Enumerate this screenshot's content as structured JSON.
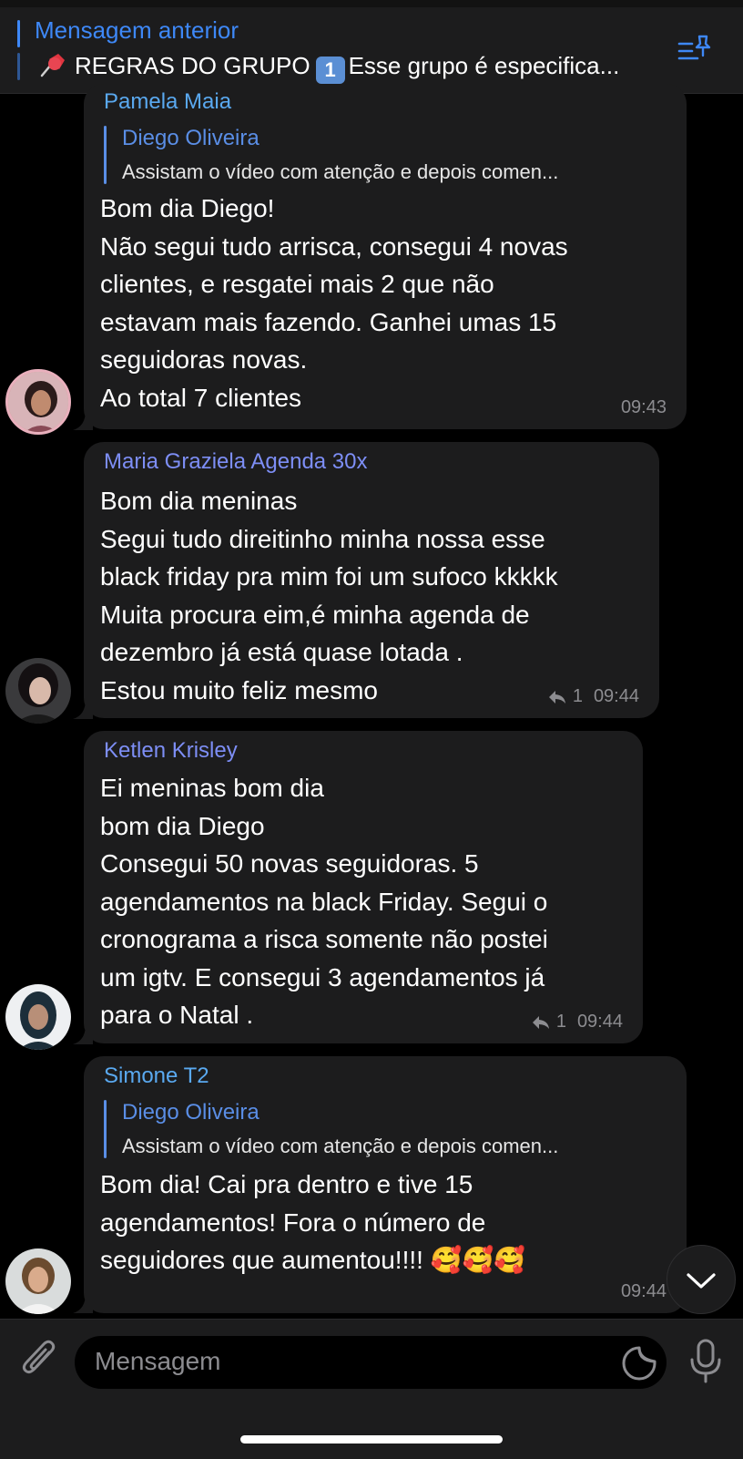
{
  "pinned": {
    "title": "Mensagem anterior",
    "text": "REGRAS DO GRUPO",
    "keycap": "1",
    "text_rest": "Esse grupo é especifica..."
  },
  "messages": [
    {
      "sender": "Pamela Maia",
      "sender_color": "#5aa9f0",
      "reply_to": {
        "name": "Diego Oliveira",
        "text": "Assistam o vídeo com atenção e depois comen..."
      },
      "lines": [
        "Bom dia Diego!",
        "Não segui tudo arrisca, consegui 4 novas",
        "clientes, e resgatei mais 2 que não",
        "estavam mais fazendo. Ganhei umas 15",
        "seguidoras novas.",
        "Ao total 7 clientes"
      ],
      "time": "09:43"
    },
    {
      "sender": "Maria Graziela Agenda 30x",
      "sender_color": "#7d8ef5",
      "lines": [
        "Bom dia meninas",
        "Segui tudo direitinho minha  nossa esse",
        "black friday pra mim foi um sufoco kkkkk",
        "Muita procura eim,é minha agenda de",
        "dezembro já está quase lotada .",
        "Estou muito feliz mesmo"
      ],
      "replies": "1",
      "time": "09:44"
    },
    {
      "sender": "Ketlen Krisley",
      "sender_color": "#7d8ef5",
      "lines": [
        "Ei meninas bom dia",
        "bom dia Diego",
        "Consegui 50 novas seguidoras. 5",
        "agendamentos na black Friday. Segui o",
        "cronograma a risca somente não postei",
        "um igtv. E consegui 3 agendamentos já",
        "para o Natal ."
      ],
      "replies": "1",
      "time": "09:44"
    },
    {
      "sender": "Simone T2",
      "sender_color": "#5aa9f0",
      "reply_to": {
        "name": "Diego Oliveira",
        "text": "Assistam o vídeo com atenção e depois comen..."
      },
      "lines": [
        "Bom dia! Cai pra dentro e tive 15",
        "agendamentos! Fora o número de",
        "seguidores que aumentou!!!! 🥰🥰🥰"
      ],
      "time": "09:44"
    }
  ],
  "composer": {
    "placeholder": "Mensagem"
  },
  "icons": {
    "pin": "pushpin-icon",
    "pinned_list": "pinned-list-icon",
    "attach": "paperclip-icon",
    "sticker": "sticker-icon",
    "mic": "microphone-icon",
    "scroll_down": "chevron-down-icon",
    "reply": "reply-arrow-icon"
  }
}
